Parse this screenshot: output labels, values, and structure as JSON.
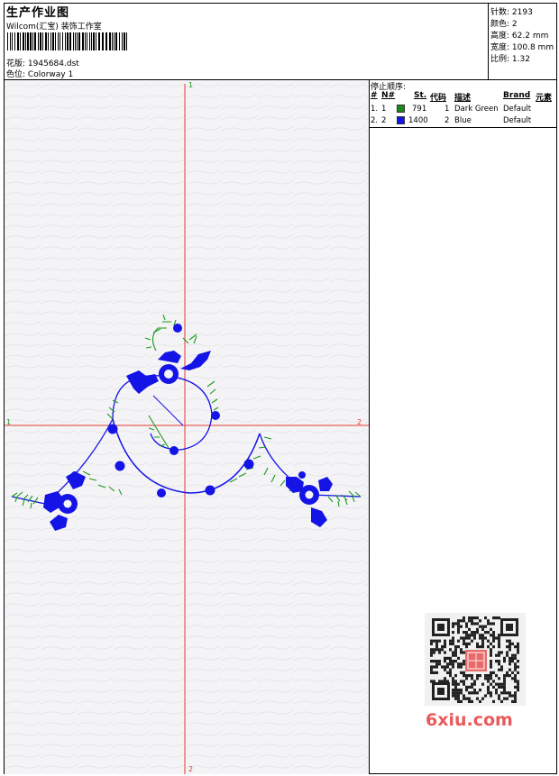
{
  "header": {
    "title": "生产作业图",
    "subtitle": "Wilcom(汇宝) 装饰工作室",
    "design_label": "花版:",
    "design_file": "1945684.dst",
    "colorway_label": "色位:",
    "colorway": "Colorway 1"
  },
  "stats": [
    {
      "label": "针数:",
      "value": "2193"
    },
    {
      "label": "颜色:",
      "value": "2"
    },
    {
      "label": "高度:",
      "value": "62.2 mm"
    },
    {
      "label": "宽度:",
      "value": "100.8 mm"
    },
    {
      "label": "比例:",
      "value": "1.32"
    }
  ],
  "canvas": {
    "axis_labels": {
      "top": "1",
      "left": "1",
      "right": "2",
      "right2": "2",
      "bottom": "2"
    },
    "axis_color": "#e53935",
    "colors": {
      "green": "#1a9a1a",
      "blue": "#1414e6"
    }
  },
  "stop_sequence": {
    "title": "停止顺序:",
    "columns": [
      "#",
      "N#",
      "St.",
      "代码",
      "描述",
      "Brand",
      "元素"
    ],
    "rows": [
      {
        "index": "1.",
        "n": "1",
        "color": "#1a8a1a",
        "stitches": "791",
        "code": "1",
        "desc": "Dark Green",
        "brand": "Default"
      },
      {
        "index": "2.",
        "n": "2",
        "color": "#1414e6",
        "stitches": "1400",
        "code": "2",
        "desc": "Blue",
        "brand": "Default"
      }
    ]
  },
  "watermark": {
    "text": "6xiu.com"
  }
}
